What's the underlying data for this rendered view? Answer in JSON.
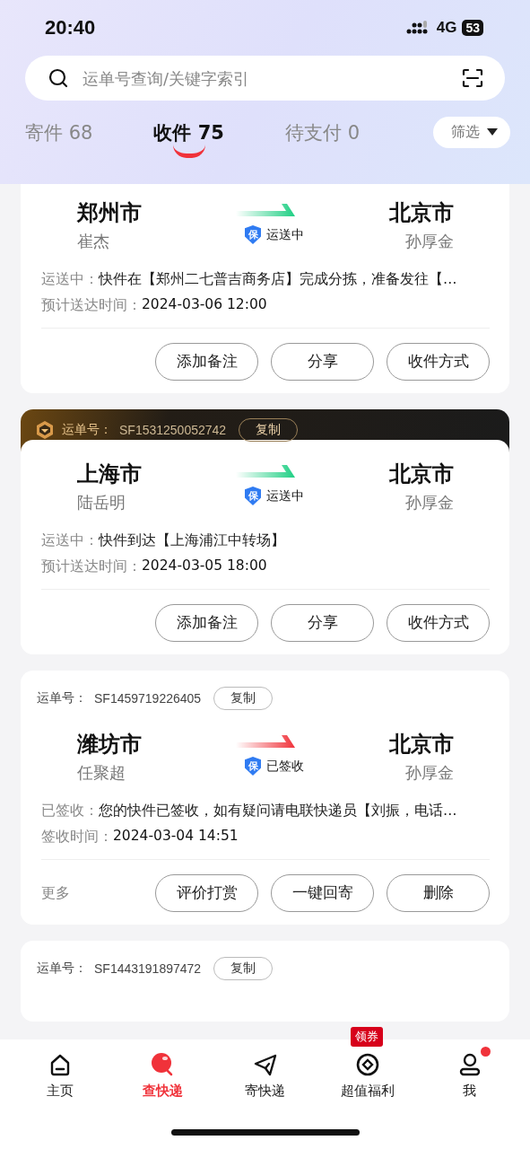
{
  "status_bar": {
    "time": "20:40",
    "network": "4G",
    "battery": "53"
  },
  "search": {
    "placeholder": "运单号查询/关键字索引"
  },
  "tabs": [
    {
      "label": "寄件 68",
      "selected": false
    },
    {
      "label": "收件 75",
      "selected": true
    },
    {
      "label": "待支付 0",
      "selected": false
    }
  ],
  "filter": {
    "label": "筛选"
  },
  "cards": [
    {
      "kind": "transit",
      "from_city": "郑州市",
      "from_name": "崔杰",
      "to_city": "北京市",
      "to_name": "孙厚金",
      "insured": "保",
      "status": "运送中",
      "progress_label": "运送中：",
      "progress_text": "快件在【郑州二七普吉商务店】完成分拣，准备发往【…",
      "time_label": "预计送达时间：",
      "time": "2024-03-06 12:00",
      "buttons": [
        "添加备注",
        "分享",
        "收件方式"
      ]
    },
    {
      "kind": "transit",
      "header": {
        "kind": "premium",
        "label": "运单号：",
        "number": "SF1531250052742",
        "copy": "复制"
      },
      "from_city": "上海市",
      "from_name": "陆岳明",
      "to_city": "北京市",
      "to_name": "孙厚金",
      "insured": "保",
      "status": "运送中",
      "progress_label": "运送中：",
      "progress_text": "快件到达【上海浦江中转场】",
      "time_label": "预计送达时间：",
      "time": "2024-03-05 18:00",
      "buttons": [
        "添加备注",
        "分享",
        "收件方式"
      ]
    },
    {
      "kind": "signed",
      "header": {
        "kind": "standard",
        "label": "运单号：",
        "number": "SF1459719226405",
        "copy": "复制"
      },
      "from_city": "潍坊市",
      "from_name": "任聚超",
      "to_city": "北京市",
      "to_name": "孙厚金",
      "insured": "保",
      "status": "已签收",
      "progress_label": "已签收：",
      "progress_text": "您的快件已签收，如有疑问请电联快递员【刘振，电话…",
      "time_label": "签收时间：",
      "time": "2024-03-04 14:51",
      "more": "更多",
      "buttons": [
        "评价打赏",
        "一键回寄",
        "删除"
      ]
    },
    {
      "kind": "cut",
      "header": {
        "kind": "standard",
        "label": "运单号：",
        "number": "SF1443191897472",
        "copy": "复制"
      }
    }
  ],
  "nav": [
    {
      "label": "主页",
      "selected": false,
      "dot": false
    },
    {
      "label": "查快递",
      "selected": true,
      "dot": false
    },
    {
      "label": "寄快递",
      "selected": false,
      "dot": false
    },
    {
      "label": "超值福利",
      "selected": false,
      "badge": "领券",
      "dot": false
    },
    {
      "label": "我",
      "selected": false,
      "dot": true
    }
  ]
}
